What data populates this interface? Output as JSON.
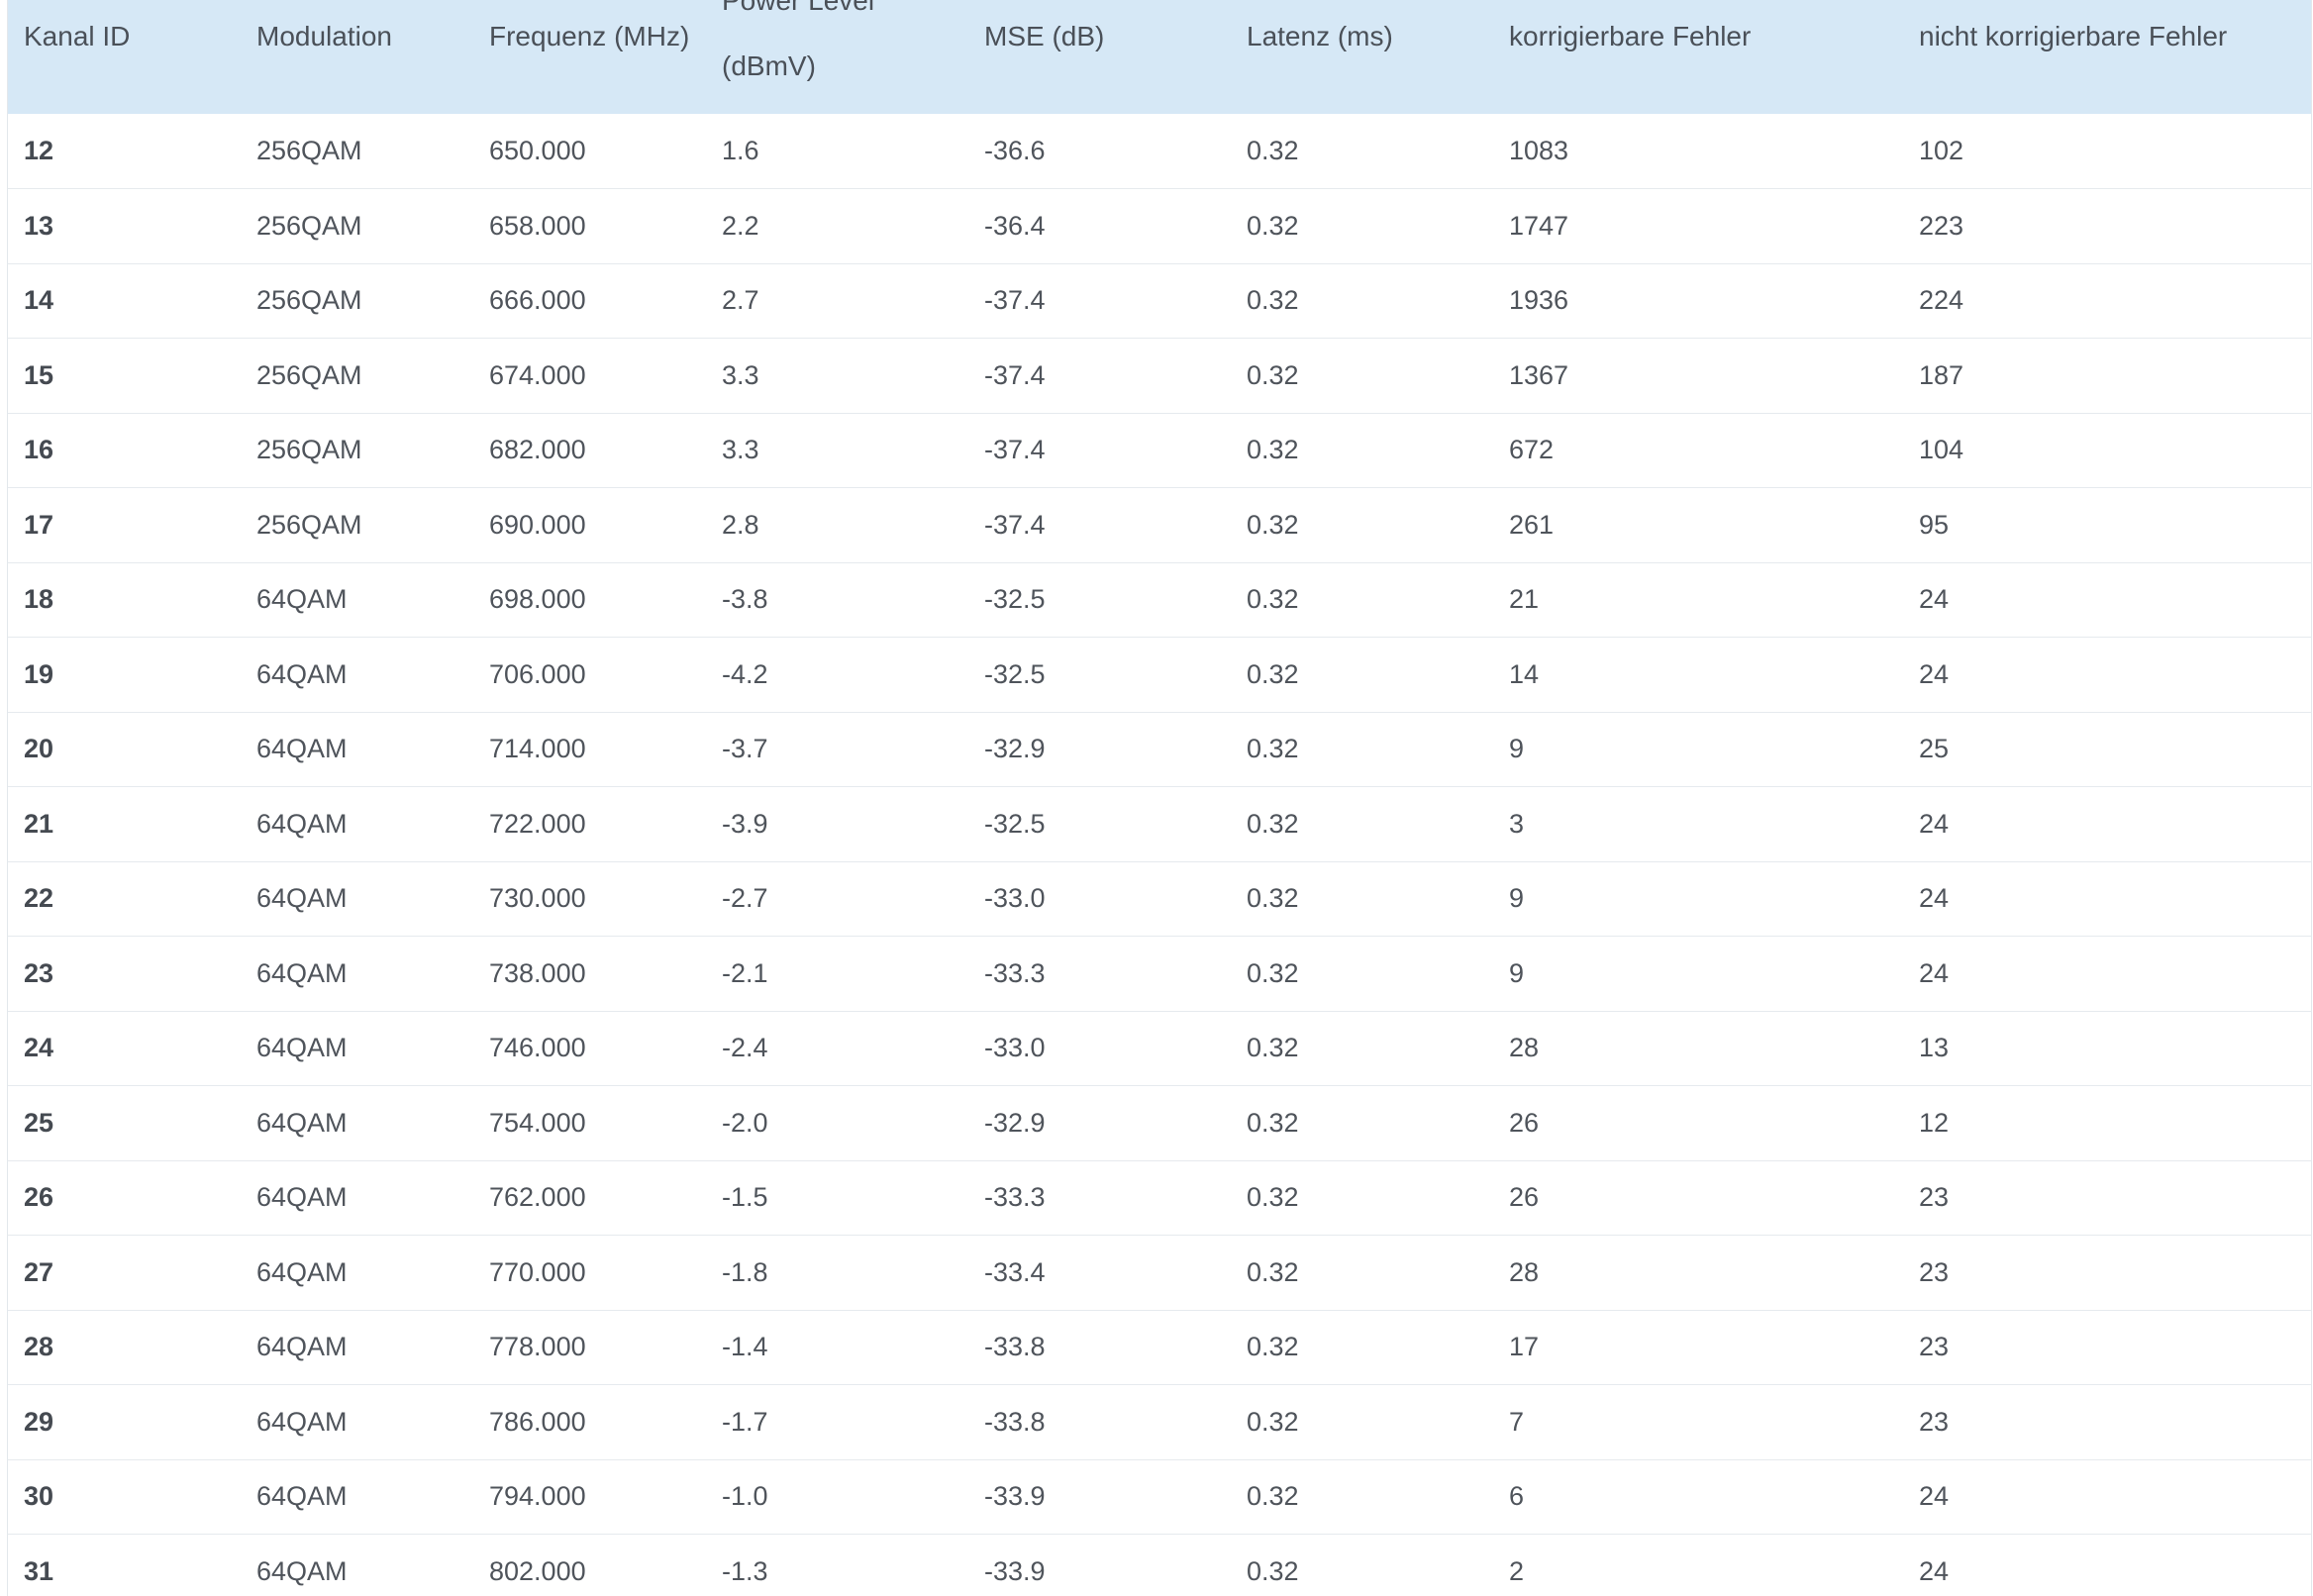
{
  "table": {
    "columns": [
      {
        "label": "Kanal ID"
      },
      {
        "label": "Modulation"
      },
      {
        "label": "Frequenz (MHz)"
      },
      {
        "label": "Power Level",
        "label2": "(dBmV)"
      },
      {
        "label": "MSE (dB)"
      },
      {
        "label": "Latenz (ms)"
      },
      {
        "label": "korrigierbare Fehler"
      },
      {
        "label": "nicht korrigierbare Fehler"
      }
    ],
    "rows": [
      [
        "12",
        "256QAM",
        "650.000",
        "1.6",
        "-36.6",
        "0.32",
        "1083",
        "102"
      ],
      [
        "13",
        "256QAM",
        "658.000",
        "2.2",
        "-36.4",
        "0.32",
        "1747",
        "223"
      ],
      [
        "14",
        "256QAM",
        "666.000",
        "2.7",
        "-37.4",
        "0.32",
        "1936",
        "224"
      ],
      [
        "15",
        "256QAM",
        "674.000",
        "3.3",
        "-37.4",
        "0.32",
        "1367",
        "187"
      ],
      [
        "16",
        "256QAM",
        "682.000",
        "3.3",
        "-37.4",
        "0.32",
        "672",
        "104"
      ],
      [
        "17",
        "256QAM",
        "690.000",
        "2.8",
        "-37.4",
        "0.32",
        "261",
        "95"
      ],
      [
        "18",
        "64QAM",
        "698.000",
        "-3.8",
        "-32.5",
        "0.32",
        "21",
        "24"
      ],
      [
        "19",
        "64QAM",
        "706.000",
        "-4.2",
        "-32.5",
        "0.32",
        "14",
        "24"
      ],
      [
        "20",
        "64QAM",
        "714.000",
        "-3.7",
        "-32.9",
        "0.32",
        "9",
        "25"
      ],
      [
        "21",
        "64QAM",
        "722.000",
        "-3.9",
        "-32.5",
        "0.32",
        "3",
        "24"
      ],
      [
        "22",
        "64QAM",
        "730.000",
        "-2.7",
        "-33.0",
        "0.32",
        "9",
        "24"
      ],
      [
        "23",
        "64QAM",
        "738.000",
        "-2.1",
        "-33.3",
        "0.32",
        "9",
        "24"
      ],
      [
        "24",
        "64QAM",
        "746.000",
        "-2.4",
        "-33.0",
        "0.32",
        "28",
        "13"
      ],
      [
        "25",
        "64QAM",
        "754.000",
        "-2.0",
        "-32.9",
        "0.32",
        "26",
        "12"
      ],
      [
        "26",
        "64QAM",
        "762.000",
        "-1.5",
        "-33.3",
        "0.32",
        "26",
        "23"
      ],
      [
        "27",
        "64QAM",
        "770.000",
        "-1.8",
        "-33.4",
        "0.32",
        "28",
        "23"
      ],
      [
        "28",
        "64QAM",
        "778.000",
        "-1.4",
        "-33.8",
        "0.32",
        "17",
        "23"
      ],
      [
        "29",
        "64QAM",
        "786.000",
        "-1.7",
        "-33.8",
        "0.32",
        "7",
        "23"
      ],
      [
        "30",
        "64QAM",
        "794.000",
        "-1.0",
        "-33.9",
        "0.32",
        "6",
        "24"
      ],
      [
        "31",
        "64QAM",
        "802.000",
        "-1.3",
        "-33.9",
        "0.32",
        "2",
        "24"
      ]
    ]
  }
}
